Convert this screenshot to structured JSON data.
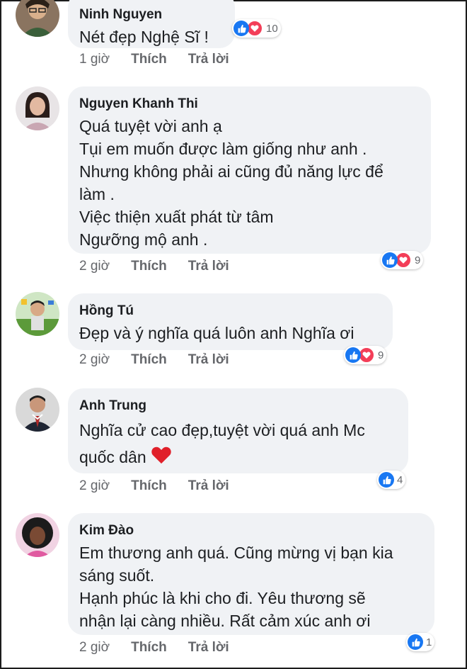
{
  "comments": [
    {
      "name": "Ninh Nguyen",
      "lines": [
        "Nét đẹp Nghệ Sĩ !"
      ],
      "time": "1 giờ",
      "like_label": "Thích",
      "reply_label": "Trả lời",
      "reaction_count": "10",
      "reactions": [
        "like-icon",
        "love-icon"
      ]
    },
    {
      "name": "Nguyen Khanh Thi",
      "lines": [
        "Quá tuyệt vời anh ạ",
        "Tụi em muốn được làm giống như anh .",
        "Nhưng không phải ai cũng đủ năng lực để",
        "làm .",
        "Việc thiện xuất phát từ tâm",
        "Ngưỡng mộ anh ."
      ],
      "time": "2 giờ",
      "like_label": "Thích",
      "reply_label": "Trả lời",
      "reaction_count": "9",
      "reactions": [
        "like-icon",
        "love-icon"
      ]
    },
    {
      "name": "Hồng Tú",
      "lines": [
        "Đẹp và ý nghĩa quá luôn anh Nghĩa ơi"
      ],
      "time": "2 giờ",
      "like_label": "Thích",
      "reply_label": "Trả lời",
      "reaction_count": "9",
      "reactions": [
        "like-icon",
        "love-icon"
      ]
    },
    {
      "name": "Anh Trung",
      "lines": [
        "Nghĩa cử cao đẹp,tuyệt vời quá anh Mc",
        "quốc dân"
      ],
      "time": "2 giờ",
      "like_label": "Thích",
      "reply_label": "Trả lời",
      "reaction_count": "4",
      "reactions": [
        "like-icon"
      ]
    },
    {
      "name": "Kim Đào",
      "lines": [
        "Em thương anh quá. Cũng mừng vị bạn kia",
        "sáng suốt.",
        "Hạnh phúc là khi cho đi. Yêu thương sẽ",
        "nhận lại càng nhiều. Rất cảm xúc anh ơi"
      ],
      "time": "2 giờ",
      "like_label": "Thích",
      "reply_label": "Trả lời",
      "reaction_count": "1",
      "reactions": [
        "like-icon"
      ]
    }
  ],
  "colors": {
    "like": "#1877f2",
    "love": "#f33e58",
    "bubble": "#f0f2f5",
    "meta": "#65676b"
  }
}
